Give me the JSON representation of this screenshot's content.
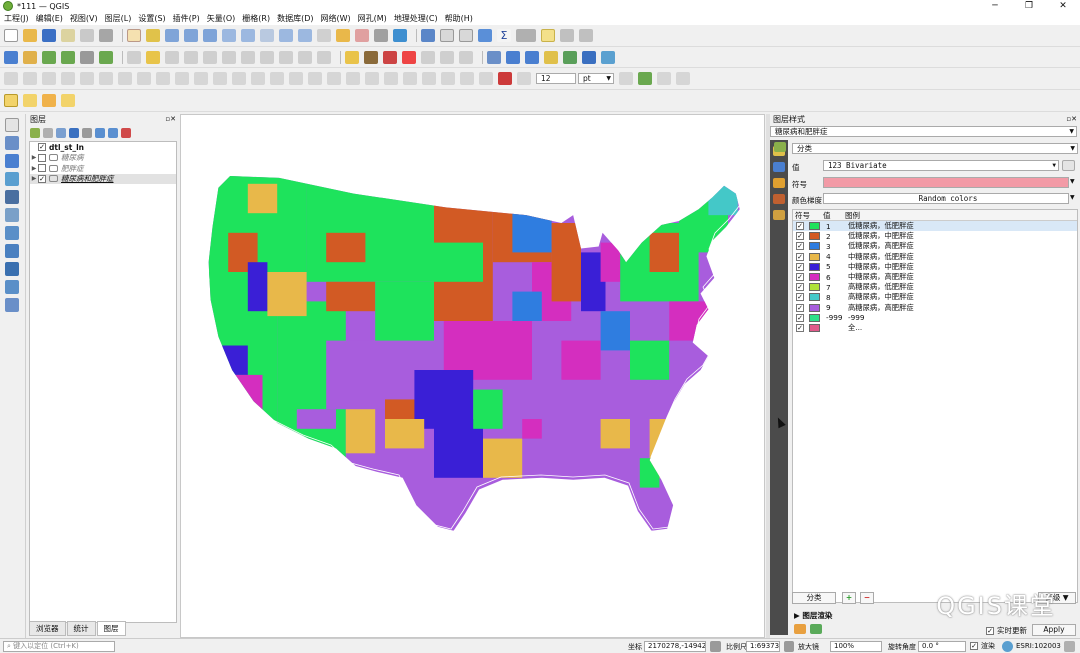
{
  "window": {
    "title": "*111 — QGIS",
    "min_glyph": "─",
    "max_glyph": "❐",
    "close_glyph": "✕"
  },
  "menu": [
    "工程(J)",
    "编辑(E)",
    "视图(V)",
    "图层(L)",
    "设置(S)",
    "插件(P)",
    "矢量(O)",
    "栅格(R)",
    "数据库(D)",
    "网络(W)",
    "网孔(M)",
    "地理处理(C)",
    "帮助(H)"
  ],
  "toolbar3": {
    "font_size": "12",
    "unit": "pt"
  },
  "layers_panel": {
    "title": "图层",
    "tabs": [
      "浏览器",
      "统计",
      "图层"
    ],
    "layers": [
      {
        "name": "dtl_st_ln",
        "checked": "✓"
      },
      {
        "name": "糖尿病",
        "checked": ""
      },
      {
        "name": "肥胖症",
        "checked": ""
      },
      {
        "name": "糖尿病和肥胖症",
        "checked": "✓"
      }
    ]
  },
  "style_panel": {
    "title": "图层样式",
    "layer": "糖尿病和肥胖症",
    "renderer": "分类",
    "value_label": "值",
    "value_field": "123 Bivariate",
    "symbol_label": "符号",
    "color_ramp_label": "颜色梯度",
    "color_ramp": "Random colors",
    "col_symbol": "符号",
    "col_value": "值",
    "col_legend": "图例",
    "classify_btn": "分类",
    "advanced_btn": "高级",
    "layer_render": "图层渲染",
    "live_update": "实时更新",
    "apply": "Apply"
  },
  "categories": [
    {
      "value": "1",
      "legend": "低糖尿病，低肥胖症",
      "color": "#1ee35c"
    },
    {
      "value": "2",
      "legend": "低糖尿病，中肥胖症",
      "color": "#d25a24"
    },
    {
      "value": "3",
      "legend": "低糖尿病，高肥胖症",
      "color": "#2f7de0"
    },
    {
      "value": "4",
      "legend": "中糖尿病，低肥胖症",
      "color": "#e8b84a"
    },
    {
      "value": "5",
      "legend": "中糖尿病，中肥胖症",
      "color": "#3a1fd6"
    },
    {
      "value": "6",
      "legend": "中糖尿病，高肥胖症",
      "color": "#d42ebf"
    },
    {
      "value": "7",
      "legend": "高糖尿病，低肥胖症",
      "color": "#aee33a"
    },
    {
      "value": "8",
      "legend": "高糖尿病，中肥胖症",
      "color": "#44c8c8"
    },
    {
      "value": "9",
      "legend": "高糖尿病，高肥胖症",
      "color": "#a85ddd"
    },
    {
      "value": "-999",
      "legend": "-999",
      "color": "#2ee08a"
    },
    {
      "value": "",
      "legend": "全...",
      "color": "#e05a8a"
    }
  ],
  "symbol_color": "#f29aa6",
  "statusbar": {
    "locate_placeholder": "键入以定位 (Ctrl+K)",
    "coord_label": "坐标",
    "coord": "2170278,-1494232",
    "scale_label": "比例尺",
    "scale": "1:6937376",
    "magnifier_label": "放大镜",
    "magnifier": "100%",
    "rotation_label": "旋转角度",
    "rotation": "0.0 °",
    "render_label": "渲染",
    "crs": "ESRI:102003"
  },
  "watermark": "QGIS课堂"
}
